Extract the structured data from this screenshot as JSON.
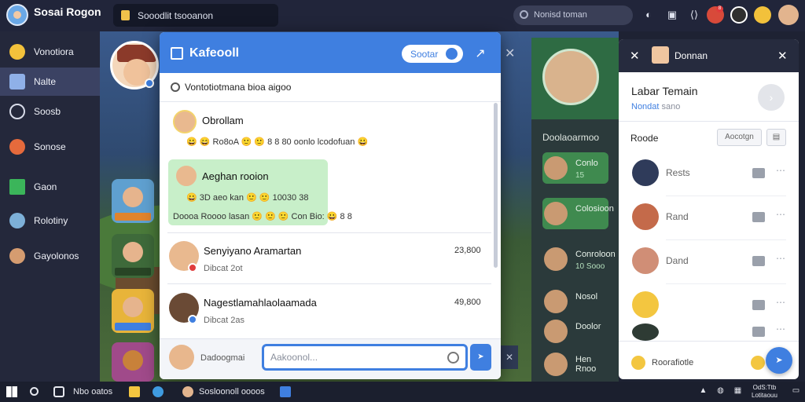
{
  "app": {
    "title": "Sosai Rogon",
    "subtitle": ""
  },
  "top_search_left": {
    "value": "Sooodlit tsooanon"
  },
  "top_search_right": {
    "placeholder": "Nonisd toman"
  },
  "notifications": {
    "count": "8"
  },
  "sidebar": {
    "items": [
      {
        "label": "Vonotiora",
        "icon": "emoji-icon",
        "color": "#f2c13b"
      },
      {
        "label": "Nalte",
        "icon": "grid-icon",
        "color": "#8fb0e8"
      },
      {
        "label": "Soosb",
        "icon": "chat-icon",
        "color": "#d7dbe8"
      },
      {
        "label": "Sonose",
        "icon": "avatar-icon",
        "color": "#e56a3c"
      },
      {
        "label": "Gaon",
        "icon": "game-icon",
        "color": "#3bb55a"
      },
      {
        "label": "Rolotiny",
        "icon": "friends-icon",
        "color": "#7db0d8"
      },
      {
        "label": "Gayolonos",
        "icon": "monkey-icon",
        "color": "#d59c70"
      }
    ]
  },
  "chat": {
    "title": "Kafeooll",
    "sort_label": "Sootar",
    "status": "Vontotiotmana bioa aigoo",
    "messages": [
      {
        "name": "Obrollam",
        "text": "😀 😄 Ro8oA 🙂 🙂 8 8 80 oonlo lcodofuan 😀",
        "time": ""
      },
      {
        "name": "Aeghan rooion",
        "text": "😀 3D aeo kan 🙂 🙂 10030 38",
        "extra": "Doooa Roooo lasan 🙂 🙂 🙂 Con Bio: 😀 8 8",
        "time": ""
      },
      {
        "name": "Senyiyano Aramartan",
        "text": "Dibcat 2ot",
        "time": "23,800"
      },
      {
        "name": "Nagestlamahlaolaamada",
        "text": "Dibcat 2as",
        "time": "49,800"
      }
    ],
    "composer": {
      "label": "Dadoogmai",
      "placeholder": "Aakoonol..."
    }
  },
  "back_panel": {
    "title": "Doolaoarmoo",
    "rows": [
      {
        "title": "Conlo",
        "sub": "15"
      },
      {
        "title": "Colosioon",
        "sub": ""
      },
      {
        "title": "Conroloon",
        "sub": "10 Sooo"
      },
      {
        "title": "Nosol",
        "sub": ""
      },
      {
        "title": "Doolor",
        "sub": ""
      },
      {
        "title": "Hen Rnoo",
        "sub": ""
      }
    ]
  },
  "team_panel": {
    "header_title": "Donnan",
    "title": "Labar Temain",
    "sub_link": "Nondat",
    "sub_muted": "sano",
    "roles_label": "Roode",
    "accept_label": "Aocotgn",
    "members": [
      {
        "name": "Rests"
      },
      {
        "name": "Rand"
      },
      {
        "name": "Dand"
      },
      {
        "name": ""
      },
      {
        "name": ""
      }
    ],
    "footer": "Roorafiotle"
  },
  "taskbar": {
    "left_text": "Nbo oatos",
    "app_text": "Sosloonoll oooos",
    "clock_time": "OdS:Ttb",
    "clock_date": "Lotitaouu"
  },
  "colors": {
    "accent": "#3f7fe0",
    "chat_bg": "#ffffff",
    "topbar": "#21253a",
    "sidebar": "#24283b"
  }
}
